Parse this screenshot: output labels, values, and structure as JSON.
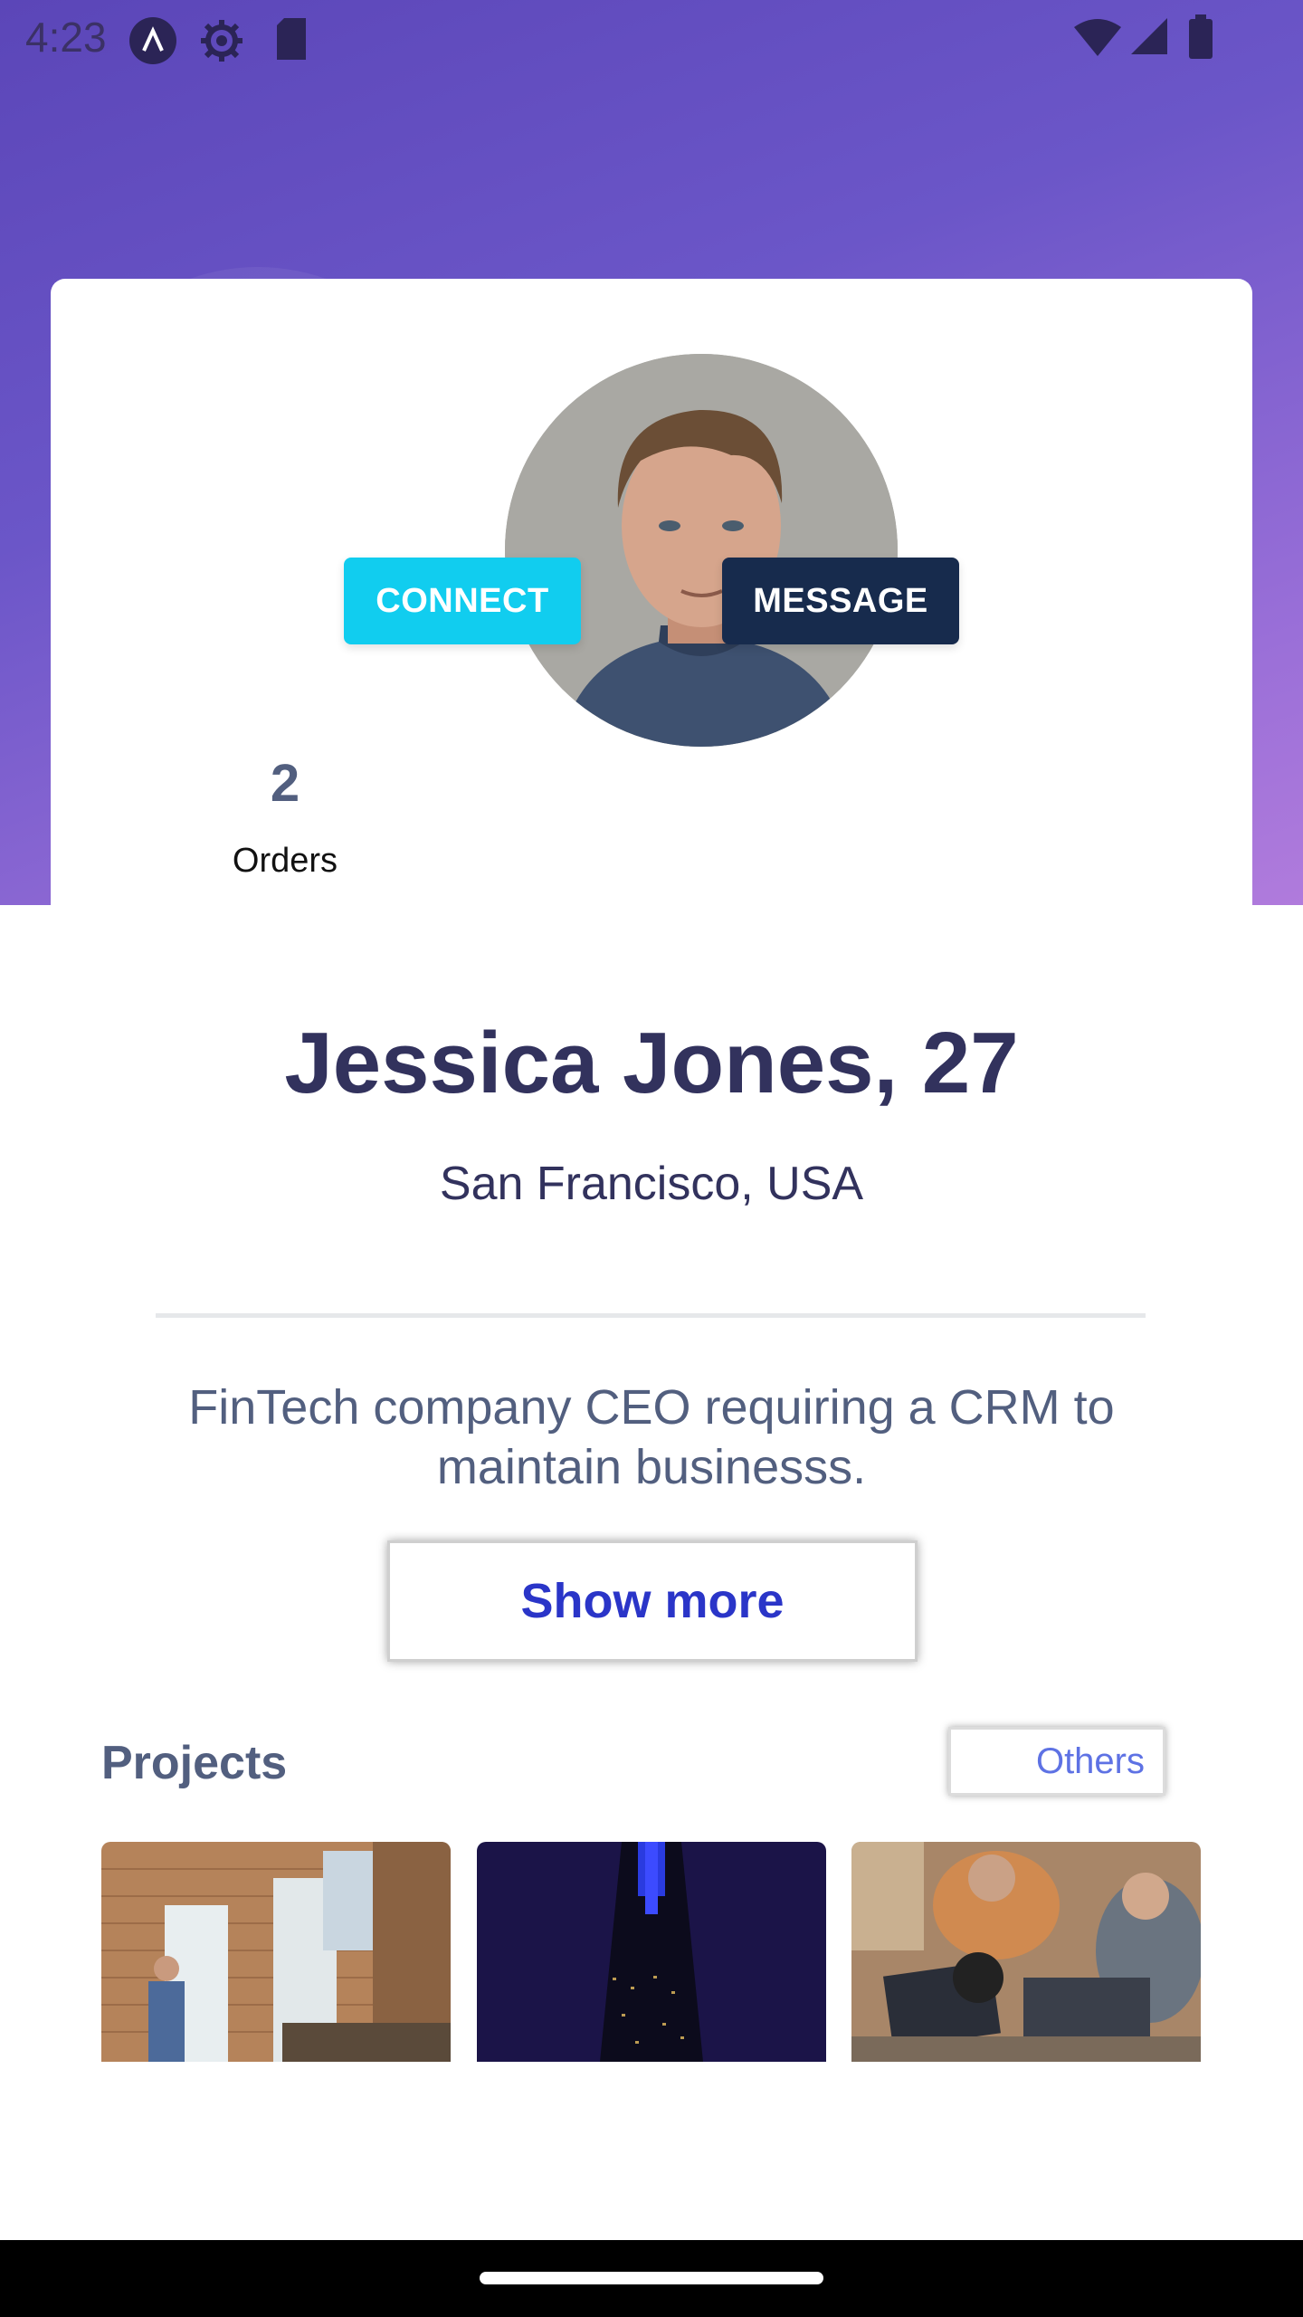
{
  "status_bar": {
    "time": "4:23",
    "icons": [
      "app-badge-icon",
      "settings-gear-icon",
      "sd-card-icon",
      "wifi-icon",
      "signal-icon",
      "battery-icon"
    ]
  },
  "profile": {
    "avatar": "profile-photo",
    "connect_label": "CONNECT",
    "message_label": "MESSAGE",
    "stats": [
      {
        "value": "2",
        "label": "Orders"
      }
    ],
    "name": "Jessica Jones, 27",
    "location": "San Francisco, USA",
    "bio_line1": "FinTech company CEO requiring a CRM to",
    "bio_line2": "maintain businesss.",
    "show_more_label": "Show more"
  },
  "projects": {
    "title": "Projects",
    "others_label": "Others",
    "items": [
      "project-presentation-photo",
      "project-tower-night-photo",
      "project-team-laptops-photo"
    ]
  },
  "colors": {
    "gradient_start": "#5b46b8",
    "gradient_end": "#b07bdc",
    "connect": "#11cdef",
    "message": "#172b4d",
    "heading": "#32325d",
    "muted": "#525f7f",
    "link": "#2a35c8"
  }
}
